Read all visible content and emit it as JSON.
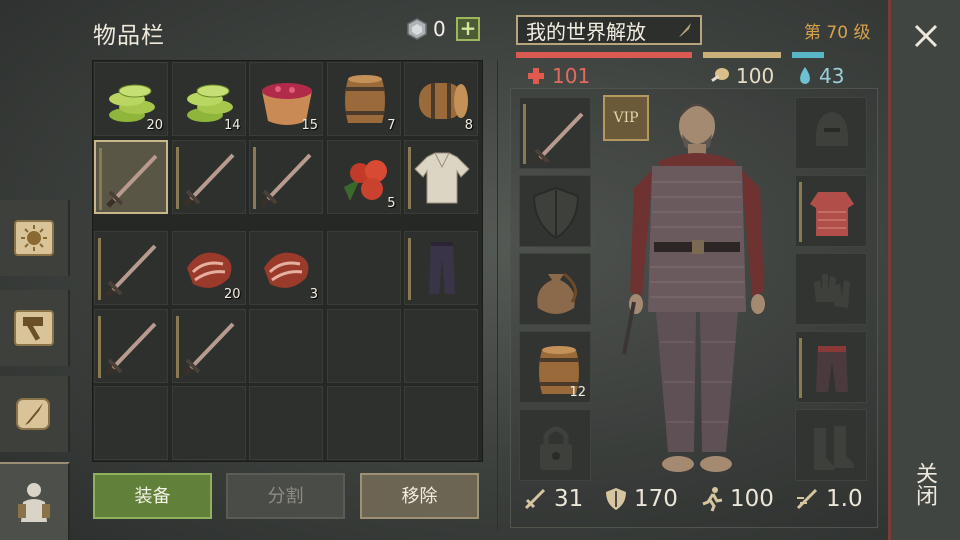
{
  "inventory": {
    "title": "物品栏",
    "coins": "0",
    "slots": [
      {
        "item": "green-coins-icon",
        "count": "20"
      },
      {
        "item": "green-coins-icon",
        "count": "14"
      },
      {
        "item": "berry-bowl-icon",
        "count": "15"
      },
      {
        "item": "barrel-icon",
        "count": "7"
      },
      {
        "item": "barrel-side-icon",
        "count": "8"
      },
      {
        "item": "sword-icon",
        "count": "",
        "selected": true
      },
      {
        "item": "sword-icon",
        "count": ""
      },
      {
        "item": "sword-icon",
        "count": ""
      },
      {
        "item": "apples-icon",
        "count": "5"
      },
      {
        "item": "shirt-icon",
        "count": ""
      },
      {
        "item": "sword-icon",
        "count": ""
      },
      {
        "item": "meat-icon",
        "count": "20"
      },
      {
        "item": "meat-icon",
        "count": "3"
      },
      {
        "item": "",
        "count": ""
      },
      {
        "item": "pants-icon",
        "count": ""
      },
      {
        "item": "sword-icon",
        "count": ""
      },
      {
        "item": "sword-icon",
        "count": ""
      }
    ],
    "buttons": {
      "equip": "装备",
      "split": "分割",
      "remove": "移除"
    }
  },
  "character": {
    "name": "我的世界解放",
    "level": "第 70 级",
    "hp": "101",
    "food": "100",
    "water": "43",
    "water_fraction": 0.41,
    "vip": "VIP",
    "left_slots": [
      {
        "item": "sword-icon",
        "count": ""
      },
      {
        "item": "shield-icon",
        "count": ""
      },
      {
        "item": "bag-icon",
        "count": ""
      },
      {
        "item": "barrel-icon",
        "count": "12"
      },
      {
        "item": "lock-icon",
        "count": ""
      }
    ],
    "right_slots": [
      {
        "item": "helmet-icon"
      },
      {
        "item": "chainmail-icon"
      },
      {
        "item": "gloves-icon"
      },
      {
        "item": "chain-pants-icon"
      },
      {
        "item": "boots-icon"
      }
    ],
    "stats": {
      "attack": "31",
      "defense": "170",
      "speed": "100",
      "attack_speed": "1.0"
    }
  },
  "close": {
    "label": "关闭"
  },
  "colors": {
    "hp": "#d85a52",
    "food": "#c9b07a",
    "water": "#59b6c8",
    "level": "#d6a24c",
    "equip_button": "#61813a"
  }
}
